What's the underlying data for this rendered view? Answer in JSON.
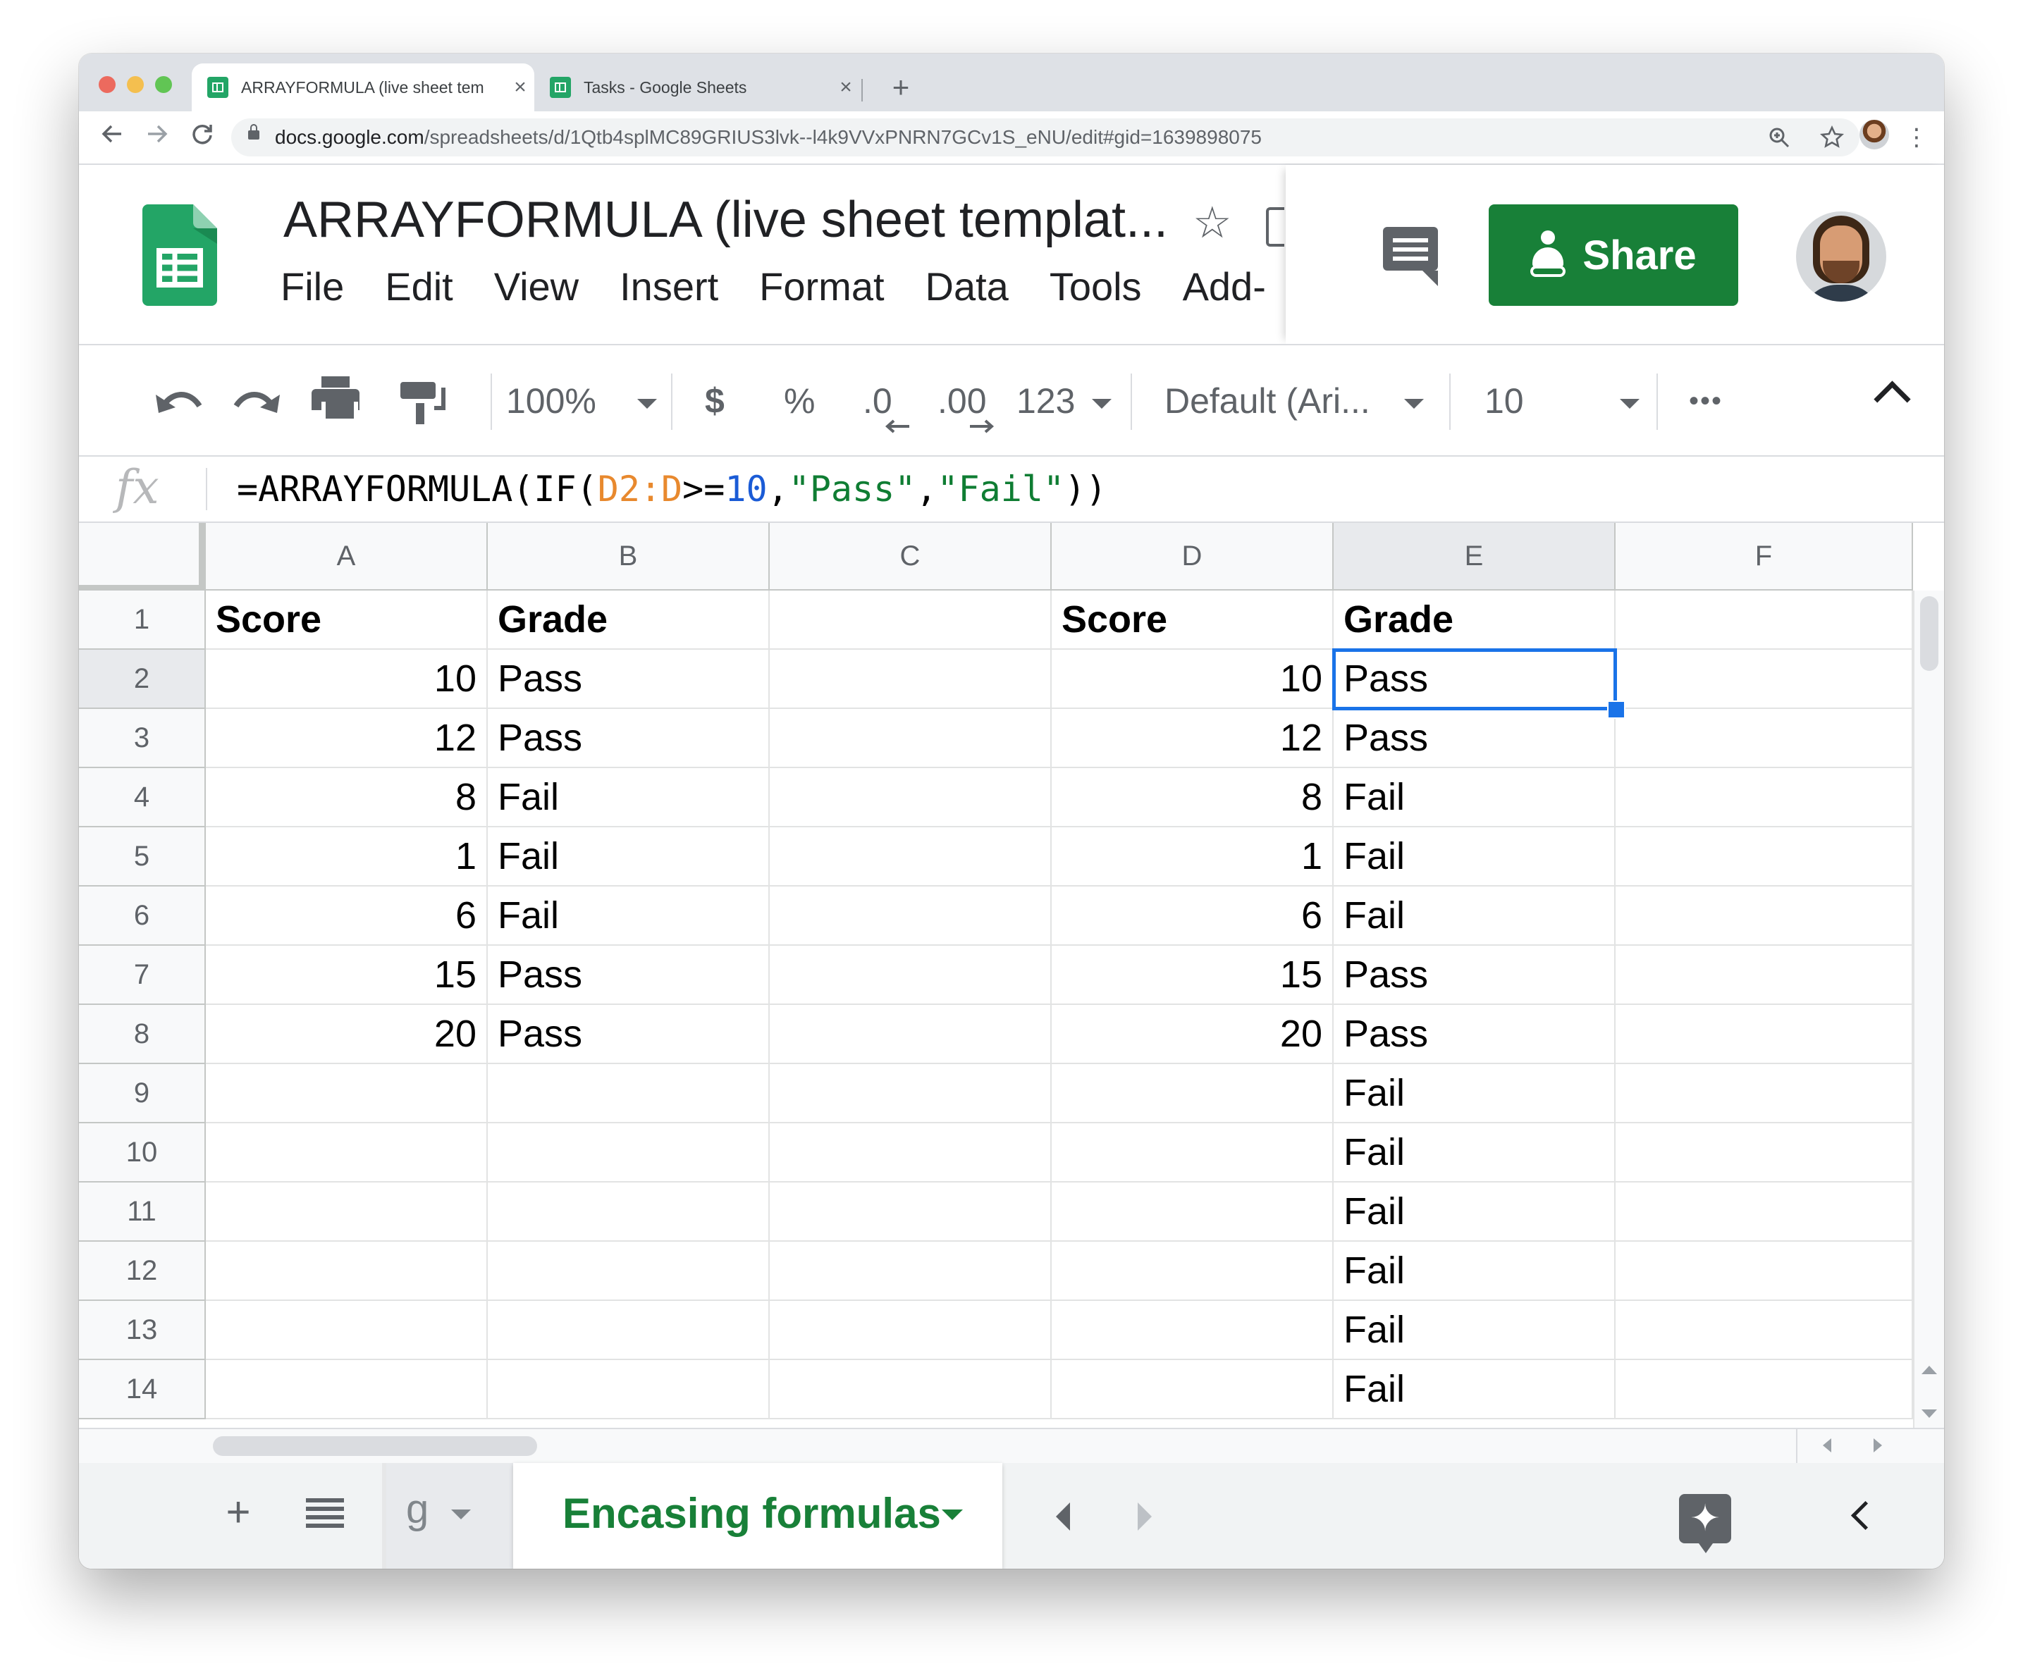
{
  "browser": {
    "tabs": [
      {
        "title": "ARRAYFORMULA (live sheet tem",
        "close": "×"
      },
      {
        "title": "Tasks - Google Sheets",
        "close": "×"
      }
    ],
    "new_tab": "+",
    "url_host": "docs.google.com",
    "url_path": "/spreadsheets/d/1Qtb4splMC89GRIUS3lvk--l4k9VVxPNRN7GCv1S_eNU/edit#gid=1639898075",
    "colors": {
      "close": "#ec6a5e",
      "minimize": "#f4bf4f",
      "maximize": "#61c554"
    }
  },
  "doc": {
    "title": "ARRAYFORMULA (live sheet templat...",
    "menu": [
      "File",
      "Edit",
      "View",
      "Insert",
      "Format",
      "Data",
      "Tools",
      "Add-"
    ],
    "share_label": "Share",
    "brand_color": "#188038"
  },
  "toolbar": {
    "zoom": "100%",
    "currency": "$",
    "percent": "%",
    "decrease_decimal": ".0",
    "increase_decimal": ".00",
    "number_format": "123",
    "font": "Default (Ari...",
    "font_size": "10",
    "more": "•••"
  },
  "formula_bar": {
    "fx": "fx",
    "parts": [
      {
        "text": "=ARRAYFORMULA(IF(",
        "kind": "plain"
      },
      {
        "text": "D2:D",
        "kind": "range"
      },
      {
        "text": ">=",
        "kind": "plain"
      },
      {
        "text": "10",
        "kind": "num"
      },
      {
        "text": ",",
        "kind": "plain"
      },
      {
        "text": "\"Pass\"",
        "kind": "str"
      },
      {
        "text": ",",
        "kind": "plain"
      },
      {
        "text": "\"Fail\"",
        "kind": "str"
      },
      {
        "text": "))",
        "kind": "plain"
      }
    ]
  },
  "sheet": {
    "columns": [
      "A",
      "B",
      "C",
      "D",
      "E",
      "F"
    ],
    "rows": [
      [
        "Score",
        "Grade",
        "",
        "Score",
        "Grade",
        ""
      ],
      [
        10,
        "Pass",
        "",
        10,
        "Pass",
        ""
      ],
      [
        12,
        "Pass",
        "",
        12,
        "Pass",
        ""
      ],
      [
        8,
        "Fail",
        "",
        8,
        "Fail",
        ""
      ],
      [
        1,
        "Fail",
        "",
        1,
        "Fail",
        ""
      ],
      [
        6,
        "Fail",
        "",
        6,
        "Fail",
        ""
      ],
      [
        15,
        "Pass",
        "",
        15,
        "Pass",
        ""
      ],
      [
        20,
        "Pass",
        "",
        20,
        "Pass",
        ""
      ],
      [
        "",
        "",
        "",
        "",
        "Fail",
        ""
      ],
      [
        "",
        "",
        "",
        "",
        "Fail",
        ""
      ],
      [
        "",
        "",
        "",
        "",
        "Fail",
        ""
      ],
      [
        "",
        "",
        "",
        "",
        "Fail",
        ""
      ],
      [
        "",
        "",
        "",
        "",
        "Fail",
        ""
      ],
      [
        "",
        "",
        "",
        "",
        "Fail",
        ""
      ]
    ],
    "selected": {
      "col": "E",
      "row": 2
    },
    "selection_color": "#1a73e8"
  },
  "sheet_tabs": {
    "add": "+",
    "previous_label": "g",
    "active_label": "Encasing formulas"
  }
}
